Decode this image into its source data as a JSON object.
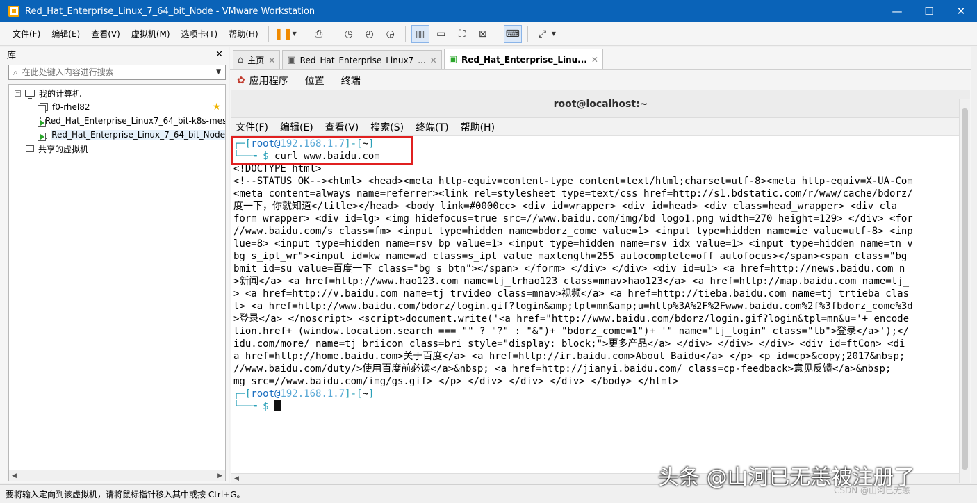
{
  "window": {
    "title": "Red_Hat_Enterprise_Linux_7_64_bit_Node - VMware Workstation",
    "minimize": "—",
    "maximize": "☐",
    "close": "✕"
  },
  "menubar": {
    "items": [
      "文件(F)",
      "编辑(E)",
      "查看(V)",
      "虚拟机(M)",
      "选项卡(T)",
      "帮助(H)"
    ]
  },
  "library": {
    "title": "库",
    "close": "✕",
    "search_placeholder": "在此处键入内容进行搜索",
    "tree": {
      "root_label": "我的计算机",
      "vms": [
        {
          "label": "f0-rhel82",
          "starred": true
        },
        {
          "label": "Red_Hat_Enterprise_Linux7_64_bit-k8s-mest",
          "starred": false
        },
        {
          "label": "Red_Hat_Enterprise_Linux_7_64_bit_Node",
          "starred": false
        }
      ],
      "shared_label": "共享的虚拟机"
    }
  },
  "tabs": [
    {
      "label": "主页",
      "icon": "home-icon"
    },
    {
      "label": "Red_Hat_Enterprise_Linux7_...",
      "icon": "vm-icon"
    },
    {
      "label": "Red_Hat_Enterprise_Linu...",
      "icon": "vm-icon"
    }
  ],
  "gnome_panel": {
    "items": [
      "应用程序",
      "位置",
      "终端"
    ]
  },
  "terminal": {
    "title": "root@localhost:~",
    "menu": [
      "文件(F)",
      "编辑(E)",
      "查看(V)",
      "搜索(S)",
      "终端(T)",
      "帮助(H)"
    ],
    "prompt": {
      "user": "root",
      "at": "@",
      "host": "192.168.1.7",
      "dir": "~"
    },
    "command": "curl www.baidu.com",
    "output": [
      "<!DOCTYPE html>",
      "<!--STATUS OK--><html> <head><meta http-equiv=content-type content=text/html;charset=utf-8><meta http-equiv=X-UA-Com",
      "<meta content=always name=referrer><link rel=stylesheet type=text/css href=http://s1.bdstatic.com/r/www/cache/bdorz/",
      "度一下，你就知道</title></head> <body link=#0000cc> <div id=wrapper> <div id=head> <div class=head_wrapper> <div cla",
      "form_wrapper> <div id=lg> <img hidefocus=true src=//www.baidu.com/img/bd_logo1.png width=270 height=129> </div> <for",
      "//www.baidu.com/s class=fm> <input type=hidden name=bdorz_come value=1> <input type=hidden name=ie value=utf-8> <inp",
      "lue=8> <input type=hidden name=rsv_bp value=1> <input type=hidden name=rsv_idx value=1> <input type=hidden name=tn v",
      "bg s_ipt_wr\"><input id=kw name=wd class=s_ipt value maxlength=255 autocomplete=off autofocus></span><span class=\"bg",
      "bmit id=su value=百度一下 class=\"bg s_btn\"></span> </form> </div> </div> <div id=u1> <a href=http://news.baidu.com n",
      ">新闻</a> <a href=http://www.hao123.com name=tj_trhao123 class=mnav>hao123</a> <a href=http://map.baidu.com name=tj_",
      "> <a href=http://v.baidu.com name=tj_trvideo class=mnav>视频</a> <a href=http://tieba.baidu.com name=tj_trtieba clas",
      "t> <a href=http://www.baidu.com/bdorz/login.gif?login&amp;tpl=mn&amp;u=http%3A%2F%2Fwww.baidu.com%2f%3fbdorz_come%3d",
      ">登录</a> </noscript> <script>document.write('<a href=\"http://www.baidu.com/bdorz/login.gif?login&tpl=mn&u='+ encode",
      "tion.href+ (window.location.search === \"\" ? \"?\" : \"&\")+ \"bdorz_come=1\")+ '\" name=\"tj_login\" class=\"lb\">登录</a>');</",
      "idu.com/more/ name=tj_briicon class=bri style=\"display: block;\">更多产品</a> </div> </div> </div> <div id=ftCon> <di",
      "a href=http://home.baidu.com>关于百度</a> <a href=http://ir.baidu.com>About Baidu</a> </p> <p id=cp>&copy;2017&nbsp;",
      "//www.baidu.com/duty/>使用百度前必读</a>&nbsp; <a href=http://jianyi.baidu.com/ class=cp-feedback>意见反馈</a>&nbsp;",
      "mg src=//www.baidu.com/img/gs.gif> </p> </div> </div> </div> </body> </html>"
    ]
  },
  "statusbar": {
    "text": "要将输入定向到该虚拟机，请将鼠标指针移入其中或按 Ctrl+G。"
  },
  "watermark": {
    "main": "头条 @山河已无恙被注册了",
    "sub": "CSDN @山河已无恙"
  }
}
